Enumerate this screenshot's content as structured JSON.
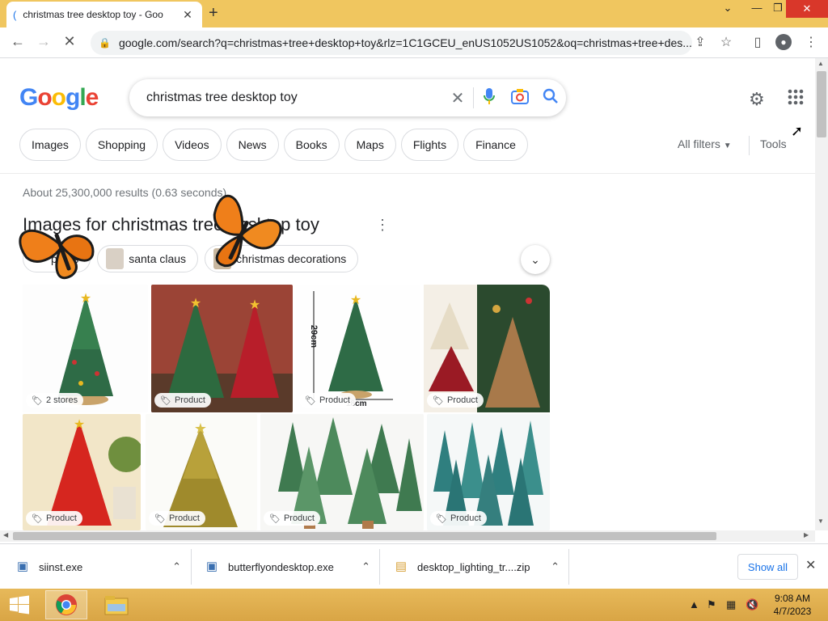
{
  "browser": {
    "tab_title": "christmas tree desktop toy - Goo",
    "url": "google.com/search?q=christmas+tree+desktop+toy&rlz=1C1GCEU_enUS1052US1052&oq=christmas+tree+des..."
  },
  "google": {
    "logo": "Google",
    "query": "christmas tree desktop toy",
    "tabs": [
      "Images",
      "Shopping",
      "Videos",
      "News",
      "Books",
      "Maps",
      "Flights",
      "Finance"
    ],
    "all_filters": "All filters",
    "tools": "Tools",
    "stats": "About 25,300,000 results (0.63 seconds)",
    "images_title": "Images for christmas tree desktop toy",
    "refinements": [
      "press",
      "santa claus",
      "christmas decorations"
    ]
  },
  "images": {
    "row1": [
      "2 stores",
      "Product",
      "Product",
      "Product"
    ],
    "row2": [
      "Product",
      "Product",
      "Product",
      "Product"
    ],
    "dimension_label_v": "29cm",
    "dimension_label_h": "18cm"
  },
  "downloads": {
    "items": [
      "siinst.exe",
      "butterflyondesktop.exe",
      "desktop_lighting_tr....zip"
    ],
    "show_all": "Show all"
  },
  "taskbar": {
    "time": "9:08 AM",
    "date": "4/7/2023"
  },
  "colors": {
    "tabstrip": "#f0c65f",
    "google_blue": "#4285f4",
    "google_red": "#ea4335",
    "google_yellow": "#fbbc05",
    "google_green": "#34a853"
  }
}
